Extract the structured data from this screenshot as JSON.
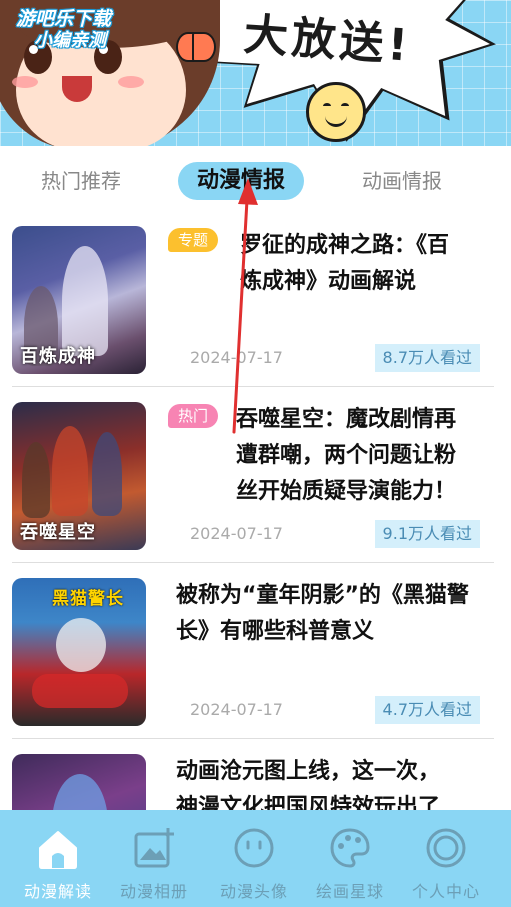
{
  "banner": {
    "headline": "大放送!",
    "watermark_line1": "游吧乐下载",
    "watermark_line2": "小编亲测"
  },
  "tabs": [
    {
      "label": "热门推荐",
      "active": false
    },
    {
      "label": "动漫情报",
      "active": true
    },
    {
      "label": "动画情报",
      "active": false
    }
  ],
  "articles": [
    {
      "badge": "专题",
      "badge_type": "topic",
      "title_line1": "罗征的成神之路：《百",
      "title_line2": "炼成神》动画解说",
      "date": "2024-07-17",
      "views": "8.7万人看过",
      "thumb_caption": "百炼成神"
    },
    {
      "badge": "热门",
      "badge_type": "hot",
      "title_line1": "吞噬星空：魔改剧情再",
      "title_line2": "遭群嘲，两个问题让粉",
      "title_line3": "丝开始质疑导演能力！",
      "date": "2024-07-17",
      "views": "9.1万人看过",
      "thumb_caption": "吞噬星空"
    },
    {
      "title_line1": "被称为“童年阴影”的《黑猫警",
      "title_line2": "长》有哪些科普意义",
      "date": "2024-07-17",
      "views": "4.7万人看过",
      "thumb_caption": "黑猫警长"
    },
    {
      "title_line1": "动画沧元图上线，这一次，",
      "title_line2": "神漫文化把国风特效玩出了"
    }
  ],
  "bottom_nav": [
    {
      "label": "动漫解读",
      "icon": "home-icon",
      "active": true
    },
    {
      "label": "动漫相册",
      "icon": "album-add-icon",
      "active": false
    },
    {
      "label": "动漫头像",
      "icon": "smiley-face-icon",
      "active": false
    },
    {
      "label": "绘画星球",
      "icon": "palette-icon",
      "active": false
    },
    {
      "label": "个人中心",
      "icon": "profile-ring-icon",
      "active": false
    }
  ],
  "colors": {
    "accent": "#8ad6f4",
    "badge_topic": "#fcc02e",
    "badge_hot": "#f784b3",
    "views_bg": "#d4effb",
    "arrow": "#e03030"
  }
}
